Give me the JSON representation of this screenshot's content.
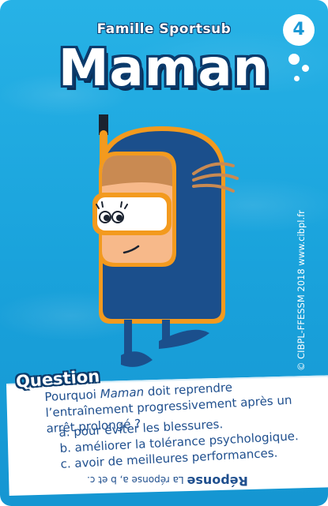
{
  "card": {
    "family": "Famille Sportsub",
    "number": "4",
    "title": "Maman",
    "copyright": "© CIBPL-FFESSM 2018 www.cibpl.fr"
  },
  "question": {
    "label": "Question",
    "text_before": "Pourquoi ",
    "text_emph": "Maman",
    "text_after": " doit reprendre l’entraînement progressivement après un arrêt prolongé ?",
    "answers": [
      "a. pour éviter les blessures.",
      "b. améliorer la tolérance psychologique.",
      "c. avoir de meilleures performances."
    ]
  },
  "answer": {
    "label": "Réponse",
    "text": "La réponse a, b et c."
  },
  "colors": {
    "sea": "#1aa3dc",
    "suit": "#1b4f8c",
    "trim": "#f39a1e",
    "skin": "#f7b98a",
    "text": "#1f4f8e"
  }
}
